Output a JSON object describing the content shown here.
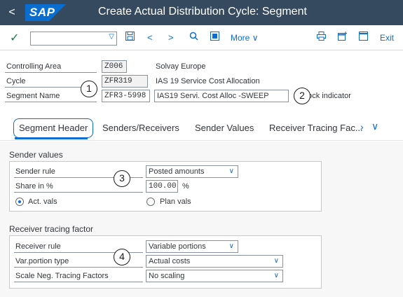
{
  "titlebar": {
    "back_glyph": "<",
    "logo_text": "SAP",
    "title": "Create Actual Distribution Cycle: Segment"
  },
  "toolbar": {
    "command_value": "",
    "more_label": "More",
    "exit_label": "Exit"
  },
  "header": {
    "controlling_area_label": "Controlling Area",
    "controlling_area_value": "Z006",
    "controlling_area_desc": "Solvay Europe",
    "cycle_label": "Cycle",
    "cycle_value": "ZFR319",
    "cycle_desc": "IAS 19 Service Cost Allocation",
    "segment_name_label": "Segment Name",
    "segment_name_value": "ZFR3-5998",
    "segment_name_desc": "IAS19 Servi. Cost Alloc -SWEEP",
    "lock_indicator_label": "Lock indicator"
  },
  "callouts": [
    "1",
    "2",
    "3",
    "4"
  ],
  "tabs": [
    {
      "label": "Segment Header",
      "active": true
    },
    {
      "label": "Senders/Receivers",
      "active": false
    },
    {
      "label": "Sender Values",
      "active": false
    },
    {
      "label": "Receiver Tracing Fac...",
      "active": false
    }
  ],
  "sender_values": {
    "section_title": "Sender values",
    "sender_rule_label": "Sender rule",
    "sender_rule_value": "Posted amounts",
    "share_label": "Share in %",
    "share_value": "100.00",
    "share_unit": "%",
    "radio_act_label": "Act. vals",
    "radio_plan_label": "Plan vals",
    "selected_radio": "act"
  },
  "receiver_tracing": {
    "section_title": "Receiver tracing factor",
    "receiver_rule_label": "Receiver rule",
    "receiver_rule_value": "Variable portions",
    "var_portion_label": "Var.portion type",
    "var_portion_value": "Actual costs",
    "scale_label": "Scale Neg. Tracing Factors",
    "scale_value": "No scaling"
  },
  "colors": {
    "shell_bar": "#354a5f",
    "accent": "#0a6ed1",
    "check": "#107e3e"
  }
}
